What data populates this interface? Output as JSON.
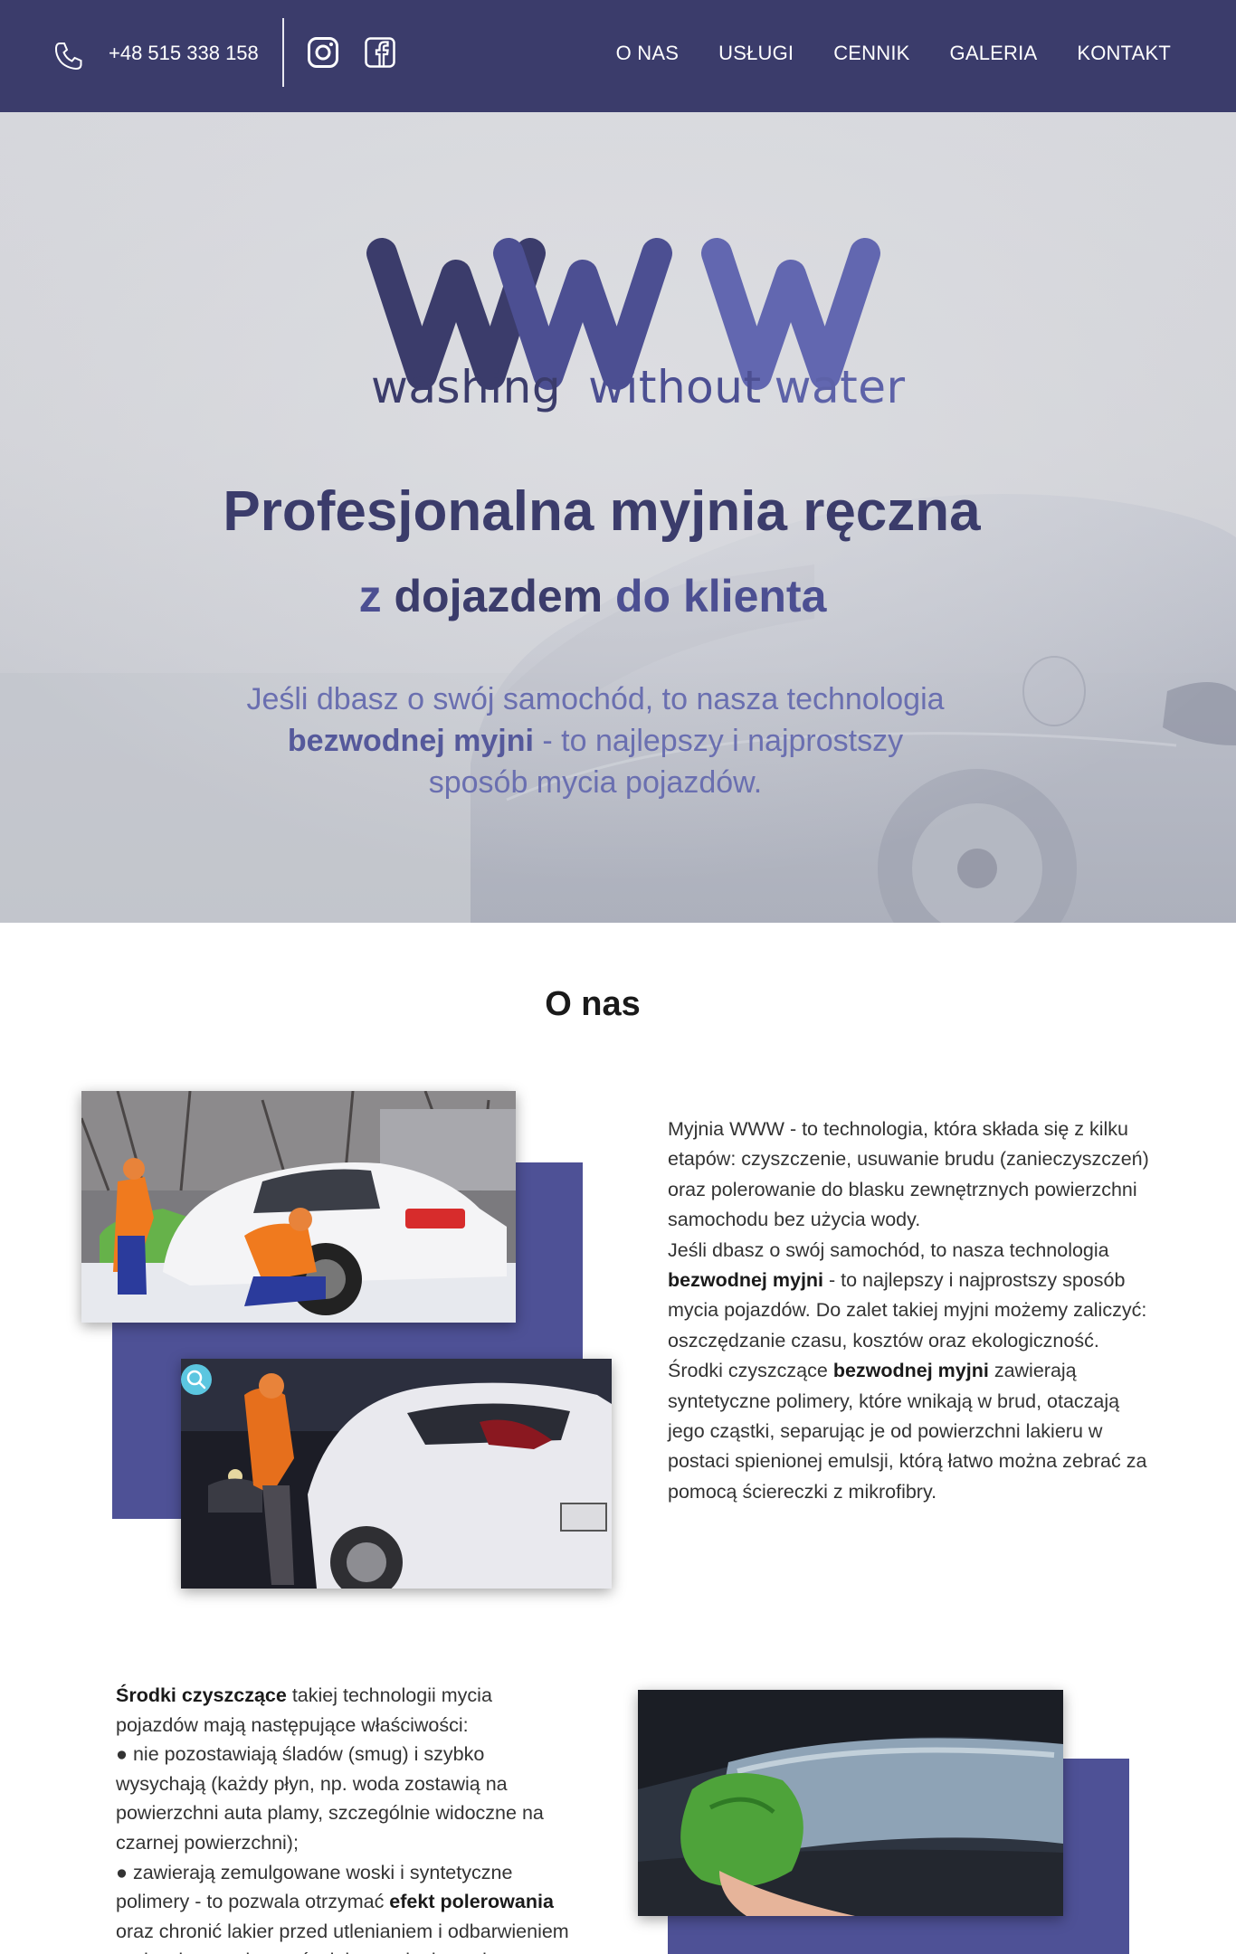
{
  "header": {
    "phone": "+48 515 338 158",
    "nav": [
      "O NAS",
      "USŁUGI",
      "CENNIK",
      "GALERIA",
      "KONTAKT"
    ]
  },
  "hero": {
    "logo_letters": "WWW",
    "logo_tagline": [
      "washing",
      "without",
      "water"
    ],
    "title": "Profesjonalna myjnia ręczna",
    "subtitle_pre": "z ",
    "subtitle_bold": "dojazdem",
    "subtitle_post": " do klienta",
    "desc_line1": "Jeśli dbasz o swój samochód, to nasza technologia",
    "desc_bold": "bezwodnej myjni",
    "desc_line2_post": " - to najlepszy i najprostszy",
    "desc_line3": "sposób mycia pojazdów."
  },
  "about": {
    "title": "O nas",
    "p1": "Myjnia WWW - to technologia, która składa się z kilku etapów: czyszczenie, usuwanie brudu (zanieczyszczeń) oraz polerowanie do blasku zewnętrznych powierzchni samochodu bez użycia wody.",
    "p2_pre": "Jeśli dbasz o swój samochód, to nasza technologia ",
    "p2_bold": "bezwodnej myjni",
    "p2_post": " - to najlepszy i najprostszy sposób mycia pojazdów. Do zalet takiej myjni możemy zaliczyć: oszczędzanie czasu, kosztów oraz ekologiczność.",
    "p3_pre": "Środki czyszczące ",
    "p3_bold": "bezwodnej myjni",
    "p3_post": " zawierają syntetyczne polimery, które wnikają w brud, otaczają jego cząstki, separując je od powierzchni lakieru w postaci spienionej emulsji, którą łatwo można zebrać za pomocą ściereczki z mikrofibry."
  },
  "properties": {
    "intro_bold": "Środki czyszczące",
    "intro_post": " takiej technologii mycia pojazdów mają następujące właściwości:",
    "item1": "● nie pozostawiają śladów (smug) i szybko wysychają (każdy płyn, np. woda zostawią na powierzchni auta plamy, szczególnie widoczne na czarnej powierzchni);",
    "item2_pre": "● zawierają zemulgowane woski i syntetyczne polimery - to pozwala otrzymać ",
    "item2_bold": "efekt polerowania",
    "item2_post": " oraz chronić lakier przed utlenianiem i odbarwieniem pod wpływem deszczów lub promieniowania"
  },
  "colors": {
    "header_bg": "#3b3c6b",
    "accent": "#4e5196",
    "logo_w1": "#3b3c6b",
    "logo_w2": "#4c4f92",
    "logo_w3": "#6267b0"
  },
  "icons": [
    "phone-icon",
    "instagram-icon",
    "facebook-icon",
    "zoom-icon"
  ]
}
